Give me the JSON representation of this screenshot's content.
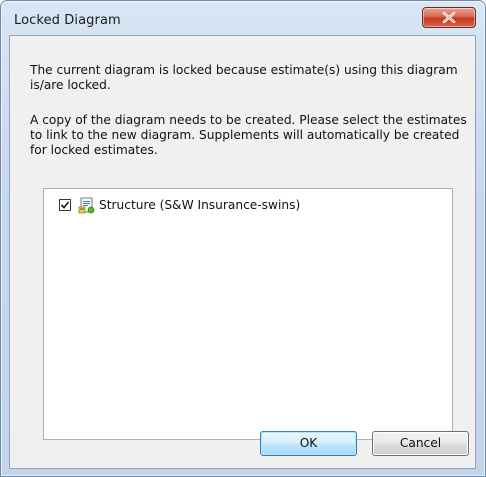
{
  "window": {
    "title": "Locked Diagram",
    "close_label": "Close"
  },
  "message": {
    "line1": "The current diagram is locked because estimate(s) using this diagram is/are locked.",
    "line2": "A copy of the diagram needs to be created.  Please select the estimates to link to the new diagram.  Supplements will automatically be created for locked estimates."
  },
  "estimates": {
    "items": [
      {
        "label": "Structure (S&W Insurance-swins)",
        "checked": true,
        "icon": "estimate-doc-icon"
      }
    ]
  },
  "buttons": {
    "ok_label": "OK",
    "cancel_label": "Cancel"
  },
  "colors": {
    "title_bar": "#c9d9ec",
    "close_button": "#c43a1f",
    "client_bg": "#f0f0f0",
    "default_button_border": "#3c7fb1"
  }
}
